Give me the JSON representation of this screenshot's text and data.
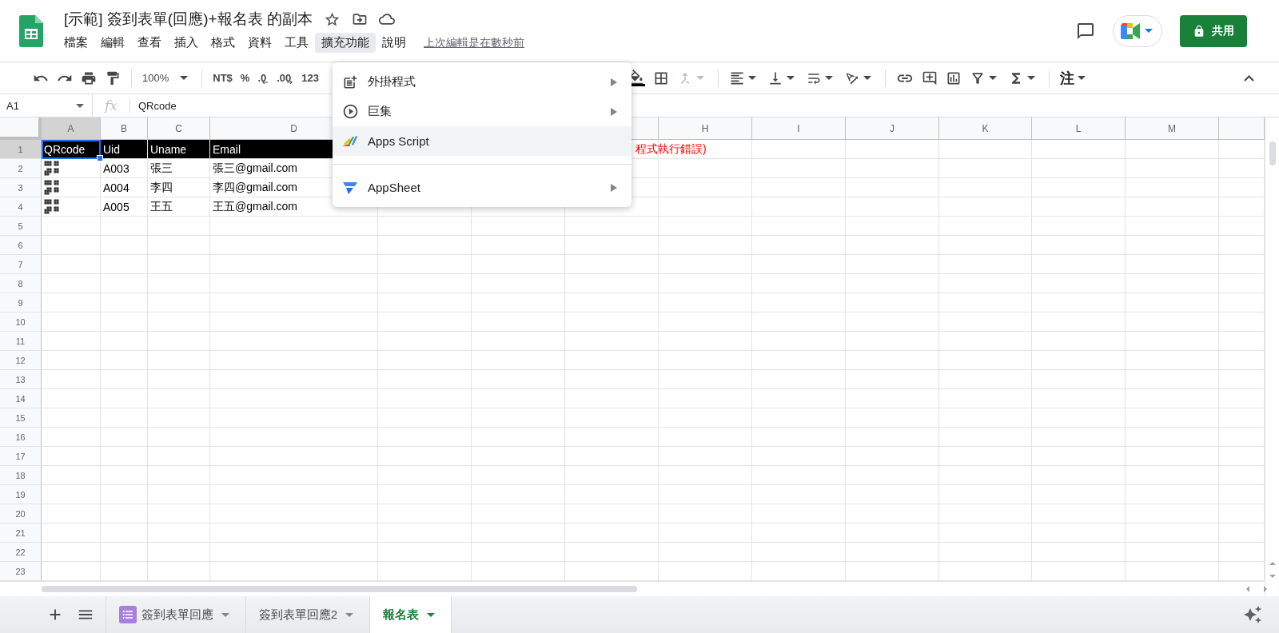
{
  "doc": {
    "title": "[示範] 簽到表單(回應)+報名表 的副本",
    "last_edit": "上次編輯是在數秒前"
  },
  "menubar": [
    {
      "label": "檔案",
      "selected": false
    },
    {
      "label": "編輯",
      "selected": false
    },
    {
      "label": "查看",
      "selected": false
    },
    {
      "label": "插入",
      "selected": false
    },
    {
      "label": "格式",
      "selected": false
    },
    {
      "label": "資料",
      "selected": false
    },
    {
      "label": "工具",
      "selected": false
    },
    {
      "label": "擴充功能",
      "selected": true
    },
    {
      "label": "說明",
      "selected": false
    }
  ],
  "share_button": "共用",
  "toolbar": {
    "zoom": "100%",
    "currency": "NT$",
    "percent": "%",
    "decrease_decimals": ".0",
    "increase_decimals": ".00",
    "more_formats": "123",
    "input_tools": "注"
  },
  "formula_bar": {
    "cell_ref": "A1",
    "fx": "fx",
    "value": "QRcode"
  },
  "columns": [
    {
      "label": "A",
      "selected": true
    },
    {
      "label": "B",
      "selected": false
    },
    {
      "label": "C",
      "selected": false
    },
    {
      "label": "D",
      "selected": false
    },
    {
      "label": "H",
      "selected": false
    },
    {
      "label": "I",
      "selected": false
    },
    {
      "label": "J",
      "selected": false
    },
    {
      "label": "K",
      "selected": false
    },
    {
      "label": "L",
      "selected": false
    },
    {
      "label": "M",
      "selected": false
    }
  ],
  "rows": [
    {
      "number": "1",
      "selected": true,
      "kind": "header",
      "note": "程式執行錯誤)",
      "cells": [
        {
          "kind": "text",
          "text": "QRcode",
          "selected": true
        },
        {
          "kind": "text",
          "text": "Uid",
          "selected": false
        },
        {
          "kind": "text",
          "text": "Uname",
          "selected": false
        },
        {
          "kind": "text",
          "text": "Email",
          "selected": false
        }
      ]
    },
    {
      "number": "2",
      "selected": false,
      "kind": "data",
      "cells": [
        {
          "kind": "qr",
          "selected": false
        },
        {
          "kind": "text",
          "text": "A003",
          "selected": false
        },
        {
          "kind": "text",
          "text": "張三",
          "selected": false
        },
        {
          "kind": "text",
          "text": "張三@gmail.com",
          "selected": false
        }
      ]
    },
    {
      "number": "3",
      "selected": false,
      "kind": "data",
      "cells": [
        {
          "kind": "qr",
          "selected": false
        },
        {
          "kind": "text",
          "text": "A004",
          "selected": false
        },
        {
          "kind": "text",
          "text": "李四",
          "selected": false
        },
        {
          "kind": "text",
          "text": "李四@gmail.com",
          "selected": false
        }
      ]
    },
    {
      "number": "4",
      "selected": false,
      "kind": "data",
      "cells": [
        {
          "kind": "qr",
          "selected": false
        },
        {
          "kind": "text",
          "text": "A005",
          "selected": false
        },
        {
          "kind": "text",
          "text": "王五",
          "selected": false
        },
        {
          "kind": "text",
          "text": "王五@gmail.com",
          "selected": false
        }
      ]
    },
    {
      "number": "5",
      "selected": false
    },
    {
      "number": "6",
      "selected": false
    },
    {
      "number": "7",
      "selected": false
    },
    {
      "number": "8",
      "selected": false
    },
    {
      "number": "9",
      "selected": false
    },
    {
      "number": "10",
      "selected": false
    },
    {
      "number": "11",
      "selected": false
    },
    {
      "number": "12",
      "selected": false
    },
    {
      "number": "13",
      "selected": false
    },
    {
      "number": "14",
      "selected": false
    },
    {
      "number": "15",
      "selected": false
    },
    {
      "number": "16",
      "selected": false
    },
    {
      "number": "17",
      "selected": false
    },
    {
      "number": "18",
      "selected": false
    },
    {
      "number": "19",
      "selected": false
    },
    {
      "number": "20",
      "selected": false
    },
    {
      "number": "21",
      "selected": false
    },
    {
      "number": "22",
      "selected": false
    },
    {
      "number": "23",
      "selected": false
    }
  ],
  "menu": [
    {
      "kind": "item",
      "label": "外掛程式",
      "submenu": true,
      "selected": false
    },
    {
      "kind": "item",
      "label": "巨集",
      "submenu": true,
      "selected": false
    },
    {
      "kind": "item",
      "label": "Apps Script",
      "submenu": false,
      "selected": true
    },
    {
      "kind": "separator"
    },
    {
      "kind": "item",
      "label": "AppSheet",
      "submenu": true,
      "selected": false
    }
  ],
  "sheets": [
    {
      "label": "簽到表單回應",
      "kind": "form",
      "selected": false
    },
    {
      "label": "簽到表單回應2",
      "kind": "plain",
      "selected": false
    },
    {
      "label": "報名表",
      "kind": "plain",
      "selected": true
    }
  ]
}
